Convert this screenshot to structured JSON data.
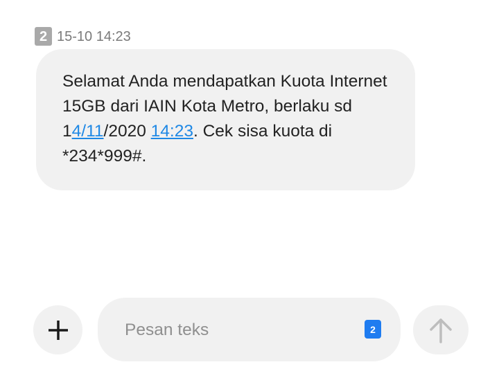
{
  "message": {
    "sim_label": "2",
    "timestamp": "15-10 14:23",
    "text_part1": "Selamat Anda mendapatkan Kuota Internet 15GB dari IAIN Kota Metro, berlaku sd 1",
    "link_date": "4/11",
    "text_part2": "/2020 ",
    "link_time": "14:23",
    "text_part3": ". Cek sisa kuota di *234*999#."
  },
  "composer": {
    "placeholder": "Pesan teks",
    "sim_label": "2",
    "add_icon": "plus-icon",
    "send_icon": "arrow-up-icon"
  },
  "colors": {
    "link": "#1e88e5",
    "sim_select": "#1f7cf0",
    "bubble": "#f1f1f1"
  }
}
